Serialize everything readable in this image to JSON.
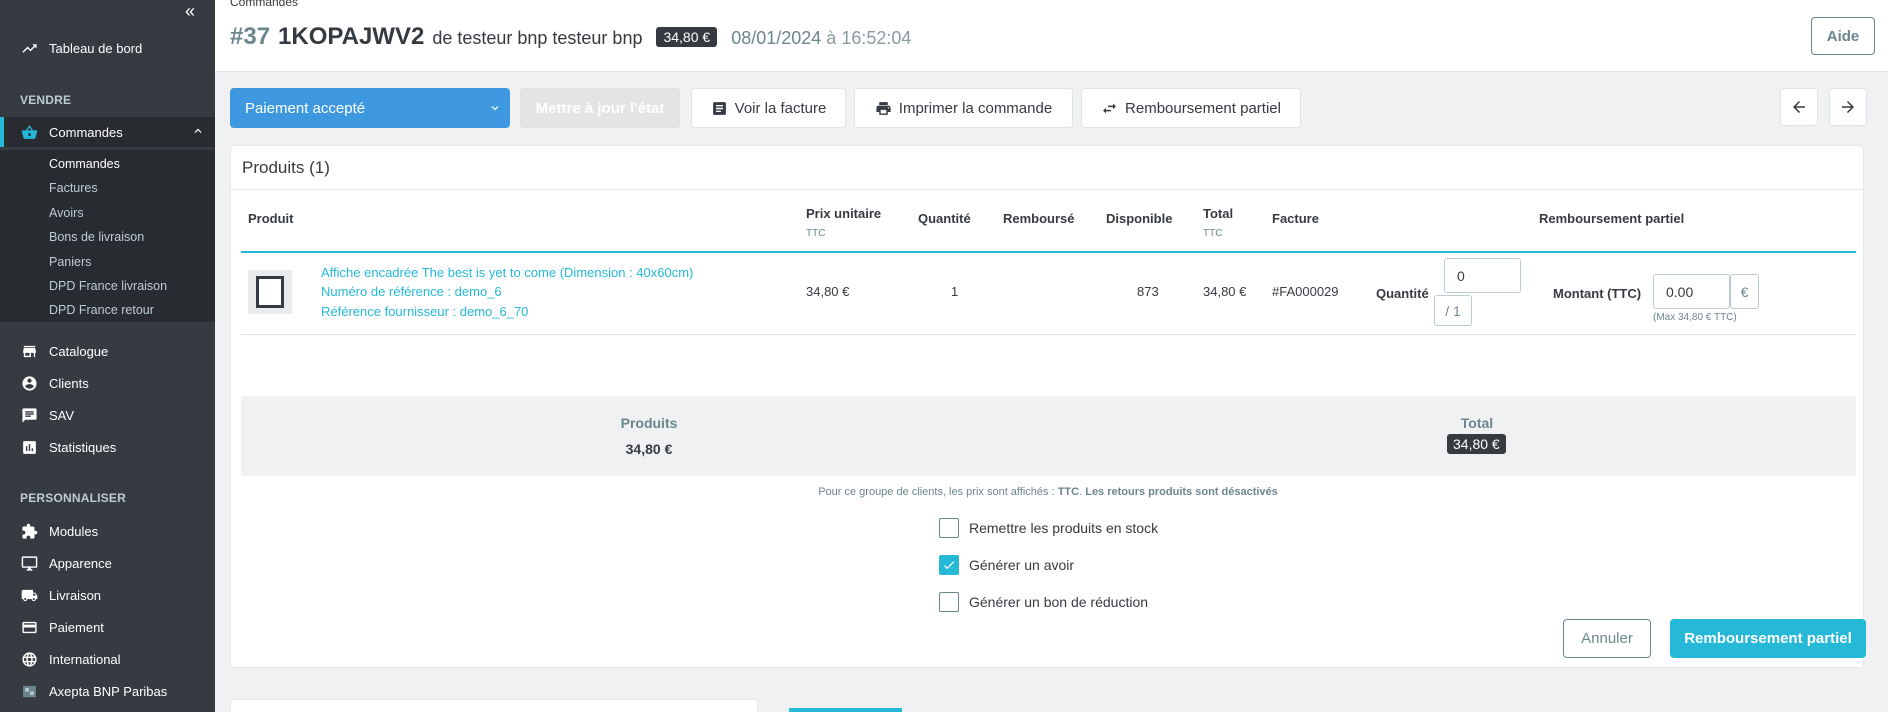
{
  "sidebar": {
    "collapse_icon": "double-chevron-left-icon",
    "dashboard": "Tableau de bord",
    "section_sell": "VENDRE",
    "orders": "Commandes",
    "sub_items": [
      "Commandes",
      "Factures",
      "Avoirs",
      "Bons de livraison",
      "Paniers",
      "DPD France livraison",
      "DPD France retour"
    ],
    "catalog": "Catalogue",
    "customers": "Clients",
    "sav": "SAV",
    "stats": "Statistiques",
    "section_customize": "PERSONNALISER",
    "modules": "Modules",
    "appearance": "Apparence",
    "shipping": "Livraison",
    "payment": "Paiement",
    "international": "International",
    "axepta": "Axepta BNP Paribas"
  },
  "header": {
    "breadcrumb": "Commandes",
    "order_number": "#37",
    "order_reference": "1KOPAJWV2",
    "customer": "de testeur bnp testeur bnp",
    "total_badge": "34,80 €",
    "date": "08/01/2024",
    "date_sep": "à",
    "time": "16:52:04",
    "help": "Aide"
  },
  "toolbar": {
    "status": "Paiement accepté",
    "update_state": "Mettre à jour l'état",
    "view_invoice": "Voir la facture",
    "print_order": "Imprimer la commande",
    "partial_refund": "Remboursement partiel"
  },
  "products": {
    "title": "Produits (1)",
    "columns": {
      "product": "Produit",
      "unit_price": "Prix unitaire",
      "unit_price_sub": "TTC",
      "quantity": "Quantité",
      "refunded": "Remboursé",
      "available": "Disponible",
      "total": "Total",
      "total_sub": "TTC",
      "invoice": "Facture",
      "partial_refund": "Remboursement partiel"
    },
    "row": {
      "name": "Affiche encadrée The best is yet to come (Dimension : 40x60cm)",
      "reference": "Numéro de référence : demo_6",
      "supplier_reference": "Référence fournisseur : demo_6_70",
      "unit_price": "34,80 €",
      "quantity": "1",
      "available": "873",
      "total": "34,80 €",
      "invoice": "#FA000029",
      "qty_label": "Quantité",
      "qty_value": "0",
      "qty_max": "/ 1",
      "amount_label": "Montant (TTC)",
      "amount_value": "0.00",
      "currency": "€",
      "amount_max": "(Max 34,80 € TTC)"
    }
  },
  "totals": {
    "products_label": "Produits",
    "products_value": "34,80 €",
    "total_label": "Total",
    "total_value": "34,80 €"
  },
  "note": {
    "prefix": "Pour ce groupe de clients, les prix sont affichés :",
    "ttc": "TTC",
    "suffix": "Les retours produits sont désactivés"
  },
  "options": {
    "restock": "Remettre les produits en stock",
    "credit_slip": "Générer un avoir",
    "voucher": "Générer un bon de réduction"
  },
  "actions": {
    "cancel": "Annuler",
    "submit": "Remboursement partiel"
  }
}
